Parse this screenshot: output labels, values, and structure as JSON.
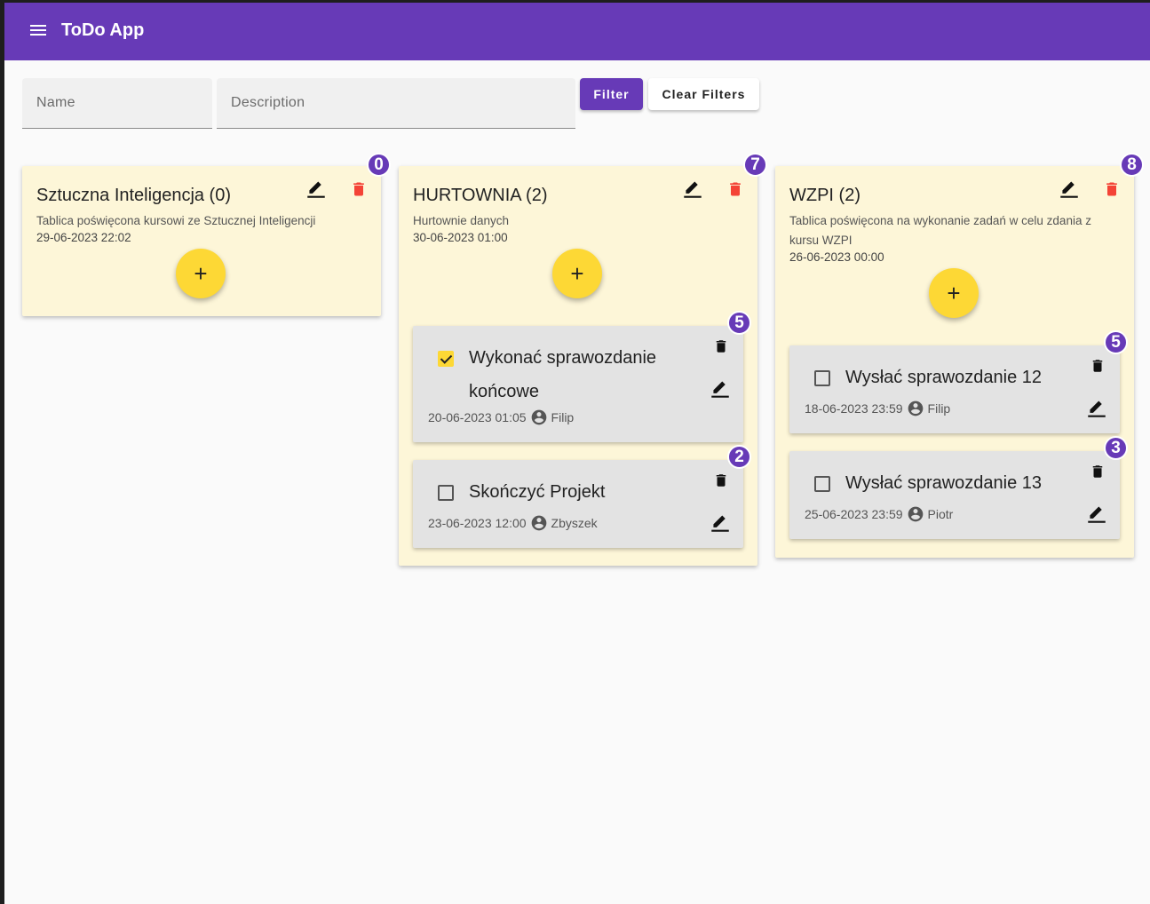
{
  "app": {
    "title": "ToDo App"
  },
  "filters": {
    "name_placeholder": "Name",
    "description_placeholder": "Description",
    "filter_label": "Filter",
    "clear_label": "Clear Filters"
  },
  "icons": {
    "menu": "menu-icon",
    "edit": "edit-icon",
    "delete": "delete-icon",
    "add": "add-icon",
    "user": "account-circle-icon"
  },
  "colors": {
    "primary": "#673ab7",
    "board_bg": "#fdf6d8",
    "task_bg": "#e3e3e3",
    "accent": "#fdd835",
    "danger": "#f44336"
  },
  "boards": [
    {
      "badge": "0",
      "title": "Sztuczna Inteligencja (0)",
      "description": "Tablica poświęcona kursowi ze Sztucznej Inteligencji",
      "date": "29-06-2023 22:02",
      "add_label": "+",
      "tasks": []
    },
    {
      "badge": "7",
      "title": "HURTOWNIA (2)",
      "description": "Hurtownie danych",
      "date": "30-06-2023 01:00",
      "add_label": "+",
      "tasks": [
        {
          "badge": "5",
          "title": "Wykonać sprawozdanie końcowe",
          "checked": true,
          "date": "20-06-2023 01:05",
          "user": "Filip"
        },
        {
          "badge": "2",
          "title": "Skończyć Projekt",
          "checked": false,
          "date": "23-06-2023 12:00",
          "user": "Zbyszek"
        }
      ]
    },
    {
      "badge": "8",
      "title": "WZPI (2)",
      "description": "Tablica poświęcona na wykonanie zadań w celu zdania z kursu WZPI",
      "date": "26-06-2023 00:00",
      "add_label": "+",
      "tasks": [
        {
          "badge": "5",
          "title": "Wysłać sprawozdanie 12",
          "checked": false,
          "date": "18-06-2023 23:59",
          "user": "Filip"
        },
        {
          "badge": "3",
          "title": "Wysłać sprawozdanie 13",
          "checked": false,
          "date": "25-06-2023 23:59",
          "user": "Piotr"
        }
      ]
    }
  ]
}
